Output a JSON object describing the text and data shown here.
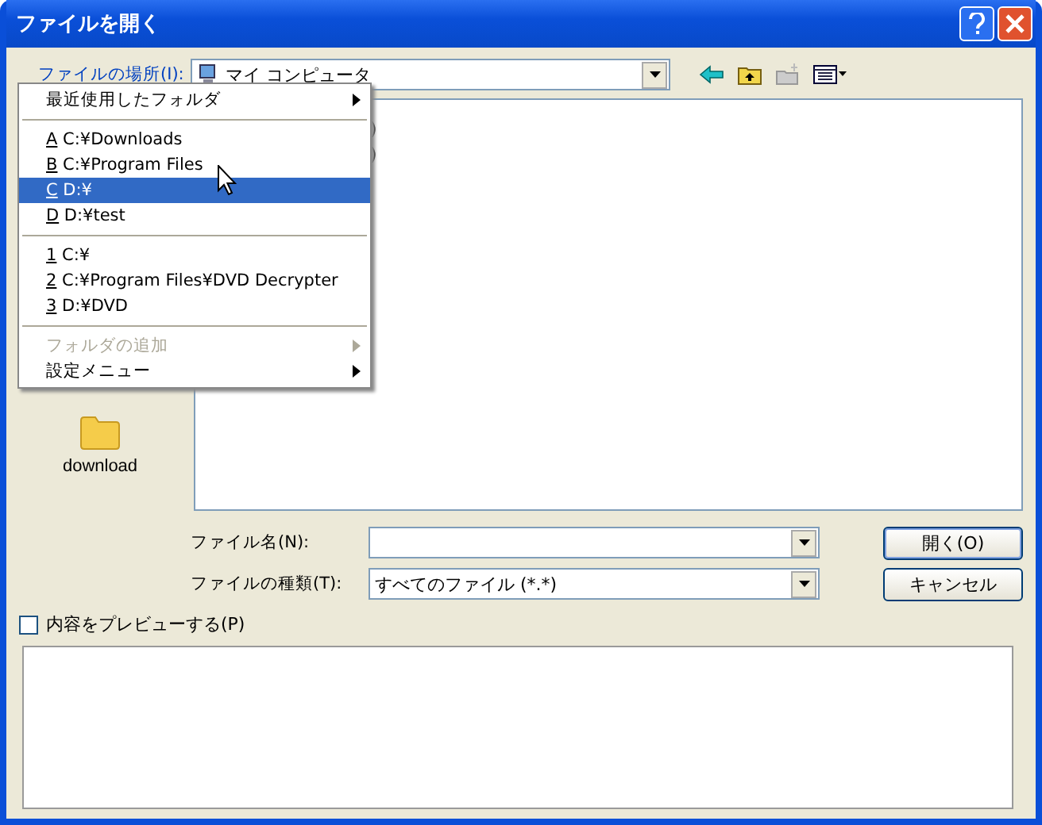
{
  "window": {
    "title": "ファイルを開く"
  },
  "look_in": {
    "label": "ファイルの場所(I):",
    "value": "マイ コンピュータ"
  },
  "places": [
    {
      "label": "download"
    }
  ],
  "file_list": [
    {
      "name": ")"
    },
    {
      "name": ")"
    }
  ],
  "menu": [
    {
      "kind": "item",
      "label": "最近使用したフォルダ",
      "submenu": true,
      "disabled": false,
      "selected": false
    },
    {
      "kind": "separator"
    },
    {
      "kind": "item",
      "key": "A",
      "label": "C:¥Downloads",
      "submenu": false,
      "disabled": false,
      "selected": false
    },
    {
      "kind": "item",
      "key": "B",
      "label": "C:¥Program Files",
      "submenu": false,
      "disabled": false,
      "selected": false
    },
    {
      "kind": "item",
      "key": "C",
      "label": "D:¥",
      "submenu": false,
      "disabled": false,
      "selected": true
    },
    {
      "kind": "item",
      "key": "D",
      "label": "D:¥test",
      "submenu": false,
      "disabled": false,
      "selected": false
    },
    {
      "kind": "separator"
    },
    {
      "kind": "item",
      "key": "1",
      "label": "C:¥",
      "submenu": false,
      "disabled": false,
      "selected": false
    },
    {
      "kind": "item",
      "key": "2",
      "label": "C:¥Program Files¥DVD Decrypter",
      "submenu": false,
      "disabled": false,
      "selected": false
    },
    {
      "kind": "item",
      "key": "3",
      "label": "D:¥DVD",
      "submenu": false,
      "disabled": false,
      "selected": false
    },
    {
      "kind": "separator"
    },
    {
      "kind": "item",
      "label": "フォルダの追加",
      "submenu": true,
      "disabled": true,
      "selected": false
    },
    {
      "kind": "item",
      "label": "設定メニュー",
      "submenu": true,
      "disabled": false,
      "selected": false
    }
  ],
  "file_name": {
    "label": "ファイル名(N):"
  },
  "file_type": {
    "label": "ファイルの種類(T):",
    "value": "すべてのファイル (*.*)"
  },
  "buttons": [
    {
      "label": "開く(O)",
      "default": true
    },
    {
      "label": "キャンセル",
      "default": false
    }
  ],
  "preview": {
    "label": "内容をプレビューする(P)",
    "checked": false
  }
}
